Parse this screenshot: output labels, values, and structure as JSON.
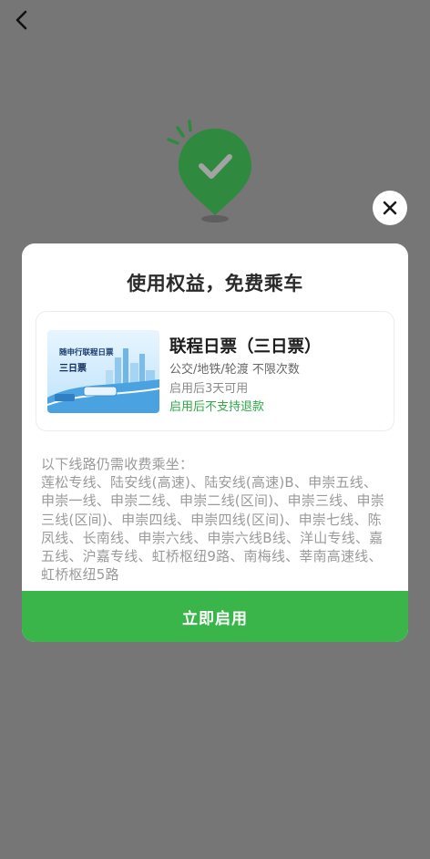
{
  "nav": {
    "back_icon": "chevron-left-icon"
  },
  "status_icon": {
    "name": "checkmark-pin-icon",
    "color": "#2f8a3f"
  },
  "modal": {
    "close_icon": "close-icon",
    "title": "使用权益，免费乘车",
    "ticket": {
      "image_title": "随申行联程日票",
      "image_subtitle": "三日票",
      "name": "联程日票（三日票）",
      "scope": "公交/地铁/轮渡 不限次数",
      "validity": "启用后3天可用",
      "refund_note": "启用后不支持退款"
    },
    "routes": {
      "heading": "以下线路仍需收费乘坐：",
      "list": "莲松专线、陆安线(高速)、陆安线(高速)B、申崇五线、申崇一线、申崇二线、申崇二线(区间)、申崇三线、申崇三线(区间)、申崇四线、申崇四线(区间)、申崇七线、陈凤线、长南线、申崇六线、申崇六线B线、洋山专线、嘉五线、沪嘉专线、虹桥枢纽9路、南梅线、莘南高速线、虹桥枢纽5路"
    },
    "primary_button": "立即启用"
  },
  "colors": {
    "overlay": "#767676",
    "accent_green": "#3ab54a",
    "refund_green": "#2eaa45"
  }
}
